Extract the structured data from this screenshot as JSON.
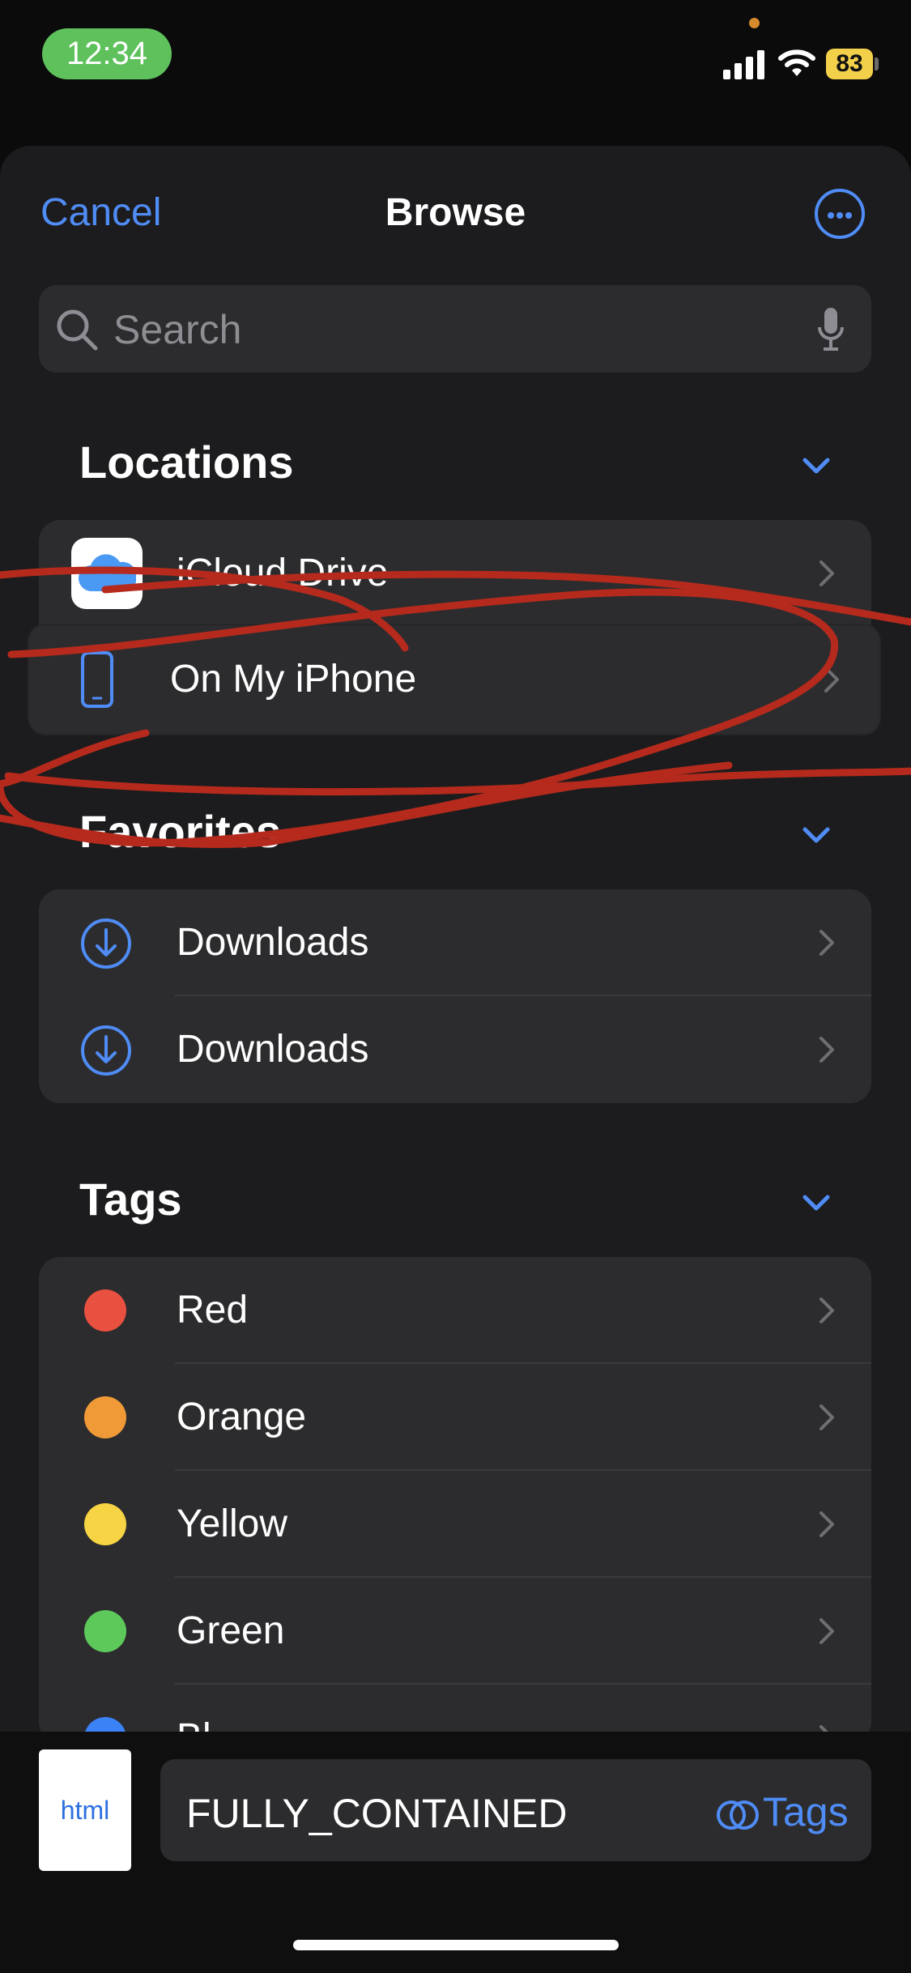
{
  "status_bar": {
    "time": "12:34",
    "battery": "83"
  },
  "nav": {
    "cancel": "Cancel",
    "title": "Browse",
    "more_icon": "ellipsis-circle-icon"
  },
  "search": {
    "placeholder": "Search"
  },
  "sections": {
    "locations": {
      "title": "Locations",
      "items": [
        {
          "label": "iCloud Drive",
          "icon": "icloud-icon"
        },
        {
          "label": "On My iPhone",
          "icon": "iphone-icon"
        }
      ]
    },
    "favorites": {
      "title": "Favorites",
      "items": [
        {
          "label": "Downloads",
          "icon": "download-circle-icon"
        },
        {
          "label": "Downloads",
          "icon": "download-circle-icon"
        }
      ]
    },
    "tags": {
      "title": "Tags",
      "items": [
        {
          "label": "Red",
          "color": "#e8503f"
        },
        {
          "label": "Orange",
          "color": "#f09a37"
        },
        {
          "label": "Yellow",
          "color": "#f6d443"
        },
        {
          "label": "Green",
          "color": "#5dc95a"
        },
        {
          "label": "Bl",
          "color": "#3b82f6"
        }
      ]
    }
  },
  "bottom": {
    "thumb_label": "html",
    "file_name": "FULLY_CONTAINED",
    "tags_label": "Tags"
  },
  "colors": {
    "accent": "#4f8cf5",
    "annotation": "#b52a1c"
  }
}
